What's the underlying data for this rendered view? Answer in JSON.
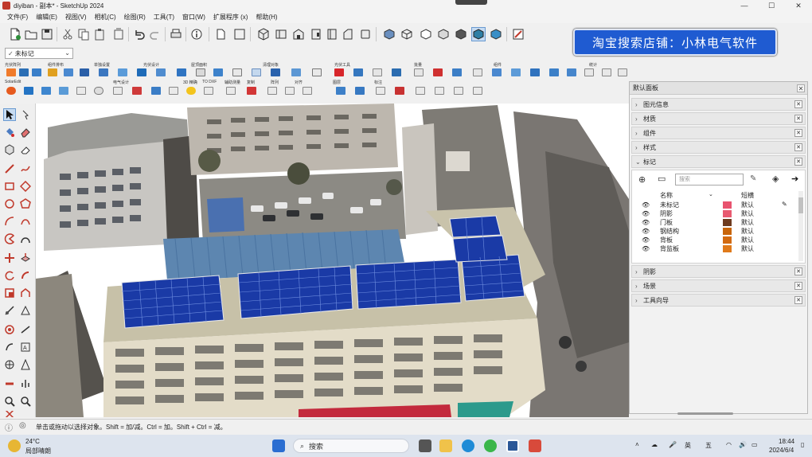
{
  "window": {
    "title": "diyiban - 副本* - SketchUp 2024",
    "minimize": "—",
    "maximize": "☐",
    "close": "✕"
  },
  "menu": [
    "文件(F)",
    "编辑(E)",
    "视图(V)",
    "相机(C)",
    "绘图(R)",
    "工具(T)",
    "窗口(W)",
    "扩展程序 (x)",
    "帮助(H)"
  ],
  "ad_banner": "淘宝搜索店铺：小林电气软件",
  "tag_dropdown": {
    "value": "未标记"
  },
  "plugin_labels_row1": [
    "光伏阵列",
    "组件排布",
    "单独设置",
    "光伏设计",
    "屋顶面积",
    "清理对象",
    "光伏工具",
    "批量",
    "组件",
    "统计"
  ],
  "plugin_labels_row2": [
    "SolarEdit",
    "电气设计",
    "3D 精确",
    "TO DXF",
    "辅助测量",
    "复制",
    "阵列",
    "对齐",
    "图层",
    "标注"
  ],
  "tray": {
    "title": "默认面板",
    "close": "✕",
    "panels_top": [
      {
        "label": "图元信息"
      },
      {
        "label": "材质"
      },
      {
        "label": "组件"
      },
      {
        "label": "样式"
      }
    ],
    "tags_panel_label": "标记",
    "tags_search_placeholder": "搜索",
    "tags_col_name": "名称",
    "tags_col_dash": "短横",
    "tags": [
      {
        "name": "未标记",
        "color": "#e8536f",
        "dash": "默认"
      },
      {
        "name": "阴影",
        "color": "#e85a70",
        "dash": "默认"
      },
      {
        "name": "门板",
        "color": "#6e3b1f",
        "dash": "默认"
      },
      {
        "name": "钢结构",
        "color": "#c8650a",
        "dash": "默认"
      },
      {
        "name": "背板",
        "color": "#d26a10",
        "dash": "默认"
      },
      {
        "name": "背监板",
        "color": "#e07a1a",
        "dash": "默认"
      }
    ],
    "panels_bottom": [
      {
        "label": "阴影"
      },
      {
        "label": "场景"
      },
      {
        "label": "工具向导"
      }
    ]
  },
  "status_text": "单击或拖动以选择对象。Shift = 加/减。Ctrl = 加。Shift + Ctrl = 减。",
  "taskbar": {
    "weather_temp": "24°C",
    "weather_desc": "局部晴朗",
    "search_placeholder": "搜索",
    "ime_lang": "英",
    "ime_mode": "五",
    "time": "18:44",
    "date": "2024/6/4"
  }
}
